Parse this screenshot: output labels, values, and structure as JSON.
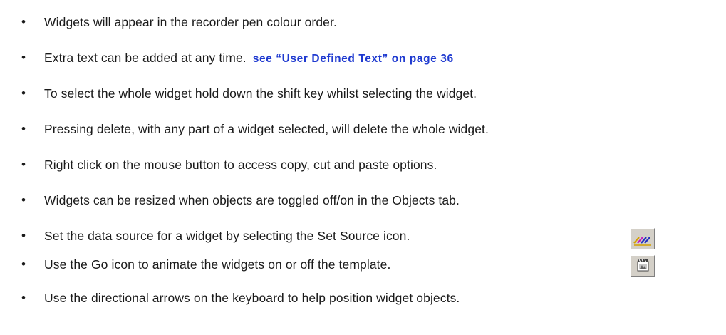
{
  "bullets": [
    {
      "text": "Widgets will appear in the recorder pen colour order."
    },
    {
      "text": "Extra text can be added at any time.",
      "link": "see “User Defined Text” on page 36"
    },
    {
      "text": "To select the whole widget hold down the shift key whilst selecting the widget."
    },
    {
      "text": "Pressing delete, with any part of a widget selected, will delete the whole widget."
    },
    {
      "text": "Right click on the mouse button to access copy, cut and paste options."
    },
    {
      "text": "Widgets can be resized when objects are toggled off/on in the Objects tab."
    },
    {
      "text": "Set the data source for a widget by selecting the Set Source icon.",
      "icon": "set-source-icon"
    },
    {
      "text": "Use the Go icon to animate the widgets on or off the template.",
      "icon": "go-icon"
    },
    {
      "text": "Use the directional arrows on the keyboard to help position widget objects."
    }
  ],
  "bullet_char": "•",
  "colors": {
    "text": "#1a1a1a",
    "link": "#1f3ad0",
    "icon_face": "#d4d0c8"
  }
}
